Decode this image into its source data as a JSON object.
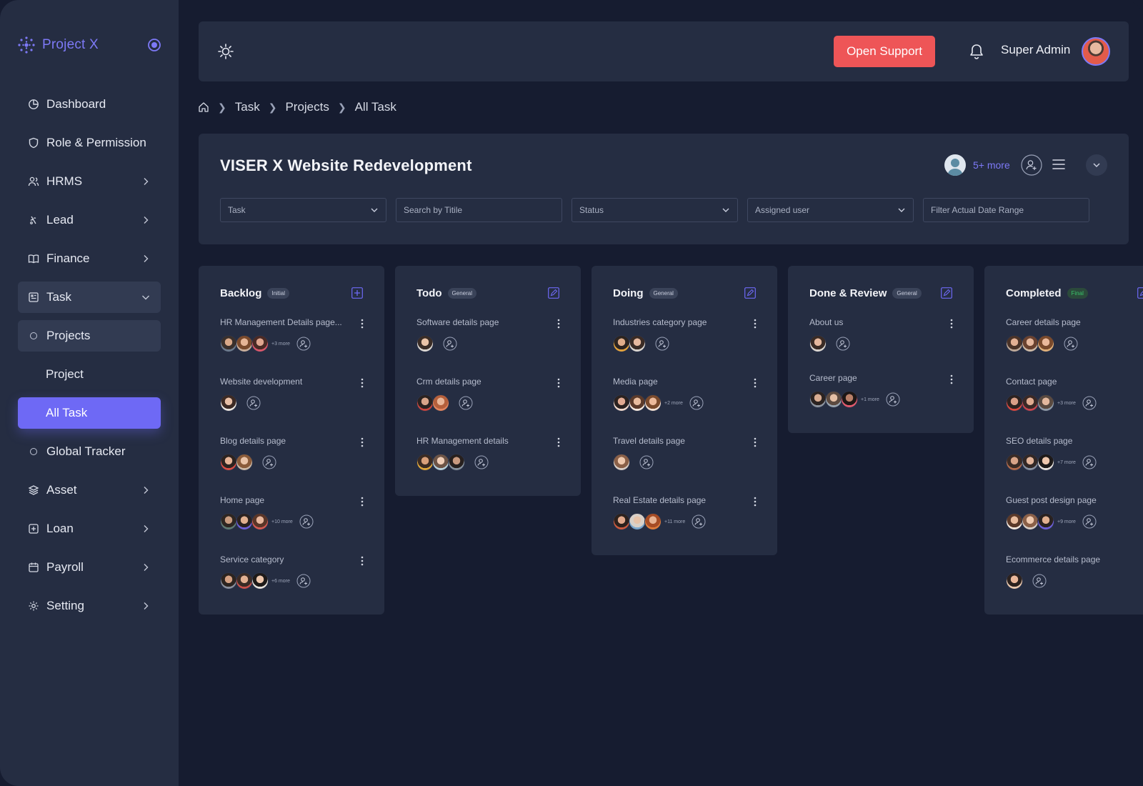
{
  "brand": {
    "name": "Project X"
  },
  "sidebar": {
    "items": [
      {
        "label": "Dashboard",
        "icon": "pie-chart-icon"
      },
      {
        "label": "Role & Permission",
        "icon": "shield-icon"
      },
      {
        "label": "HRMS",
        "icon": "users-icon"
      },
      {
        "label": "Lead",
        "icon": "lead-icon"
      },
      {
        "label": "Finance",
        "icon": "book-icon"
      },
      {
        "label": "Task",
        "icon": "task-icon"
      },
      {
        "label": "Projects"
      },
      {
        "label": "Project"
      },
      {
        "label": "All Task"
      },
      {
        "label": "Global Tracker"
      },
      {
        "label": "Asset",
        "icon": "layers-icon"
      },
      {
        "label": "Loan",
        "icon": "loan-icon"
      },
      {
        "label": "Payroll",
        "icon": "calendar-icon"
      },
      {
        "label": "Setting",
        "icon": "gear-icon"
      }
    ]
  },
  "topbar": {
    "support_label": "Open Support",
    "user_name": "Super Admin"
  },
  "breadcrumb": {
    "items": [
      "Task",
      "Projects",
      "All Task"
    ]
  },
  "project": {
    "title": "VISER X Website Redevelopment",
    "members_more": "5+ more",
    "filters": {
      "task": "Task",
      "search_placeholder": "Search by Titile",
      "status": "Status",
      "assigned": "Assigned user",
      "date_placeholder": "Filter Actual Date Range"
    }
  },
  "colors": {
    "accent": "#6e69f5",
    "danger": "#ee5557",
    "final": "#39c26a"
  },
  "columns": [
    {
      "title": "Backlog",
      "badge": "Initial",
      "tasks": [
        {
          "title": "HR Management Details page...",
          "more": "+3 more"
        },
        {
          "title": "Website development",
          "more": ""
        },
        {
          "title": "Blog details page",
          "more": ""
        },
        {
          "title": "Home page",
          "more": "+10 more"
        },
        {
          "title": "Service category",
          "more": "+6 more"
        }
      ]
    },
    {
      "title": "Todo",
      "badge": "General",
      "tasks": [
        {
          "title": "Software details page",
          "more": ""
        },
        {
          "title": "Crm details page",
          "more": ""
        },
        {
          "title": "HR Management details",
          "more": ""
        }
      ]
    },
    {
      "title": "Doing",
      "badge": "General",
      "tasks": [
        {
          "title": "Industries category page",
          "more": ""
        },
        {
          "title": "Media page",
          "more": "+2 more"
        },
        {
          "title": "Travel details page",
          "more": ""
        },
        {
          "title": "Real Estate details page",
          "more": "+11 more"
        }
      ]
    },
    {
      "title": "Done & Review",
      "badge": "General",
      "tasks": [
        {
          "title": "About us",
          "more": ""
        },
        {
          "title": "Career page",
          "more": "+1 more"
        }
      ]
    },
    {
      "title": "Completed",
      "badge": "Final",
      "tasks": [
        {
          "title": "Career details page",
          "more": ""
        },
        {
          "title": "Contact page",
          "more": "+3 more"
        },
        {
          "title": "SEO details page",
          "more": "+7 more"
        },
        {
          "title": "Guest post design page",
          "more": "+9 more"
        },
        {
          "title": "Ecommerce details page",
          "more": ""
        }
      ]
    }
  ]
}
